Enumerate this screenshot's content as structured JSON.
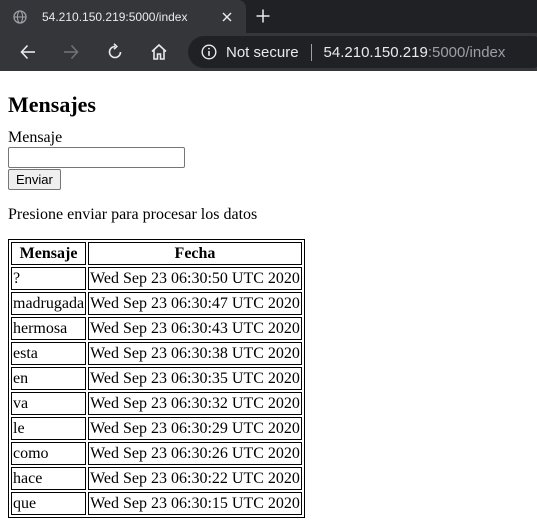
{
  "browser": {
    "tab_title": "54.210.150.219:5000/index",
    "security_label": "Not secure",
    "url_host": "54.210.150.219",
    "url_path": ":5000/index",
    "icons": [
      "favicon-globe-icon",
      "close-icon",
      "plus-icon",
      "back-arrow-icon",
      "forward-arrow-icon",
      "reload-icon",
      "home-icon",
      "info-icon"
    ]
  },
  "page": {
    "title": "Mensajes",
    "field_label": "Mensaje",
    "input_value": "",
    "input_placeholder": "",
    "send_label": "Enviar",
    "hint": "Presione enviar para procesar los datos"
  },
  "table": {
    "headers": [
      "Mensaje",
      "Fecha"
    ],
    "rows": [
      [
        "?",
        "Wed Sep 23 06:30:50 UTC 2020"
      ],
      [
        "madrugada",
        "Wed Sep 23 06:30:47 UTC 2020"
      ],
      [
        "hermosa",
        "Wed Sep 23 06:30:43 UTC 2020"
      ],
      [
        "esta",
        "Wed Sep 23 06:30:38 UTC 2020"
      ],
      [
        "en",
        "Wed Sep 23 06:30:35 UTC 2020"
      ],
      [
        "va",
        "Wed Sep 23 06:30:32 UTC 2020"
      ],
      [
        "le",
        "Wed Sep 23 06:30:29 UTC 2020"
      ],
      [
        "como",
        "Wed Sep 23 06:30:26 UTC 2020"
      ],
      [
        "hace",
        "Wed Sep 23 06:30:22 UTC 2020"
      ],
      [
        "que",
        "Wed Sep 23 06:30:15 UTC 2020"
      ]
    ]
  }
}
